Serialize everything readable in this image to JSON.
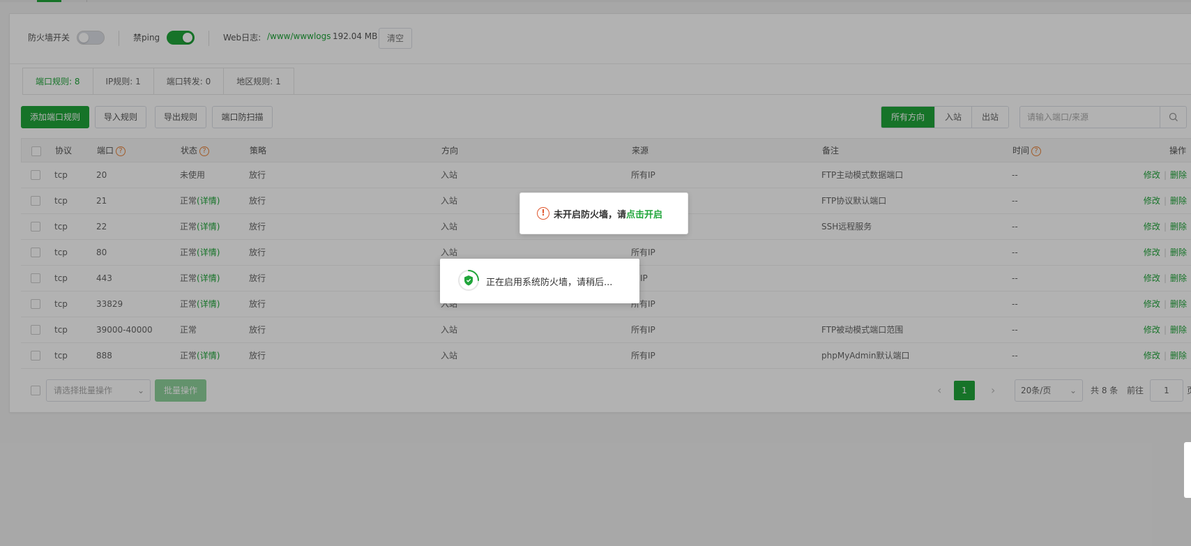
{
  "toprow": {
    "firewall_label": "防火墙开关",
    "firewall_on": false,
    "ping_label": "禁ping",
    "ping_on": true,
    "weblog_label": "Web日志:",
    "weblog_path": "/www/wwwlogs",
    "weblog_size": "192.04 MB",
    "clear_label": "清空"
  },
  "tabs": [
    {
      "label": "端口规则: 8",
      "active": true
    },
    {
      "label": "IP规则: 1",
      "active": false
    },
    {
      "label": "端口转发: 0",
      "active": false
    },
    {
      "label": "地区规则: 1",
      "active": false
    }
  ],
  "toolbar": {
    "add_label": "添加端口规则",
    "import_label": "导入规则",
    "export_label": "导出规则",
    "scan_label": "端口防扫描",
    "directions": [
      {
        "label": "所有方向",
        "active": true
      },
      {
        "label": "入站",
        "active": false
      },
      {
        "label": "出站",
        "active": false
      }
    ],
    "search_placeholder": "请输入端口/来源"
  },
  "table": {
    "headers": {
      "protocol": "协议",
      "port": "端口",
      "status": "状态",
      "policy": "策略",
      "direction": "方向",
      "source": "来源",
      "remark": "备注",
      "time": "时间",
      "action": "操作"
    },
    "help_mark": "?",
    "rows": [
      {
        "protocol": "tcp",
        "port": "20",
        "status": "未使用",
        "detail": "",
        "policy": "放行",
        "direction": "入站",
        "source": "所有IP",
        "remark": "FTP主动模式数据端口",
        "time": "--"
      },
      {
        "protocol": "tcp",
        "port": "21",
        "status": "正常",
        "detail": "(详情)",
        "policy": "放行",
        "direction": "入站",
        "source": "",
        "remark": "FTP协议默认端口",
        "time": "--"
      },
      {
        "protocol": "tcp",
        "port": "22",
        "status": "正常",
        "detail": "(详情)",
        "policy": "放行",
        "direction": "入站",
        "source": "",
        "remark": "SSH远程服务",
        "time": "--"
      },
      {
        "protocol": "tcp",
        "port": "80",
        "status": "正常",
        "detail": "(详情)",
        "policy": "放行",
        "direction": "入站",
        "source": "所有IP",
        "remark": "",
        "time": "--"
      },
      {
        "protocol": "tcp",
        "port": "443",
        "status": "正常",
        "detail": "(详情)",
        "policy": "放行",
        "direction": "",
        "source": "IP",
        "remark": "",
        "time": "--"
      },
      {
        "protocol": "tcp",
        "port": "33829",
        "status": "正常",
        "detail": "(详情)",
        "policy": "放行",
        "direction": "入站",
        "source": "所有IP",
        "remark": "",
        "time": "--"
      },
      {
        "protocol": "tcp",
        "port": "39000-40000",
        "status": "正常",
        "detail": "",
        "policy": "放行",
        "direction": "入站",
        "source": "所有IP",
        "remark": "FTP被动模式端口范围",
        "time": "--"
      },
      {
        "protocol": "tcp",
        "port": "888",
        "status": "正常",
        "detail": "(详情)",
        "policy": "放行",
        "direction": "入站",
        "source": "所有IP",
        "remark": "phpMyAdmin默认端口",
        "time": "--"
      }
    ],
    "edit_label": "修改",
    "delete_label": "删除",
    "op_sep": "|"
  },
  "footer": {
    "batch_placeholder": "请选择批量操作",
    "batch_button": "批量操作",
    "prev": "‹",
    "next": "›",
    "current_page": "1",
    "page_size": "20条/页",
    "total": "共 8 条",
    "goto_label": "前往",
    "goto_value": "1",
    "page_suffix": "页"
  },
  "message": {
    "icon": "!",
    "text": "未开启防火墙，请",
    "link": "点击开启"
  },
  "loading": {
    "text": "正在启用系统防火墙，请稍后..."
  },
  "colors": {
    "brand": "#20a53a",
    "warning": "#e8833a",
    "error": "#e0572e"
  }
}
